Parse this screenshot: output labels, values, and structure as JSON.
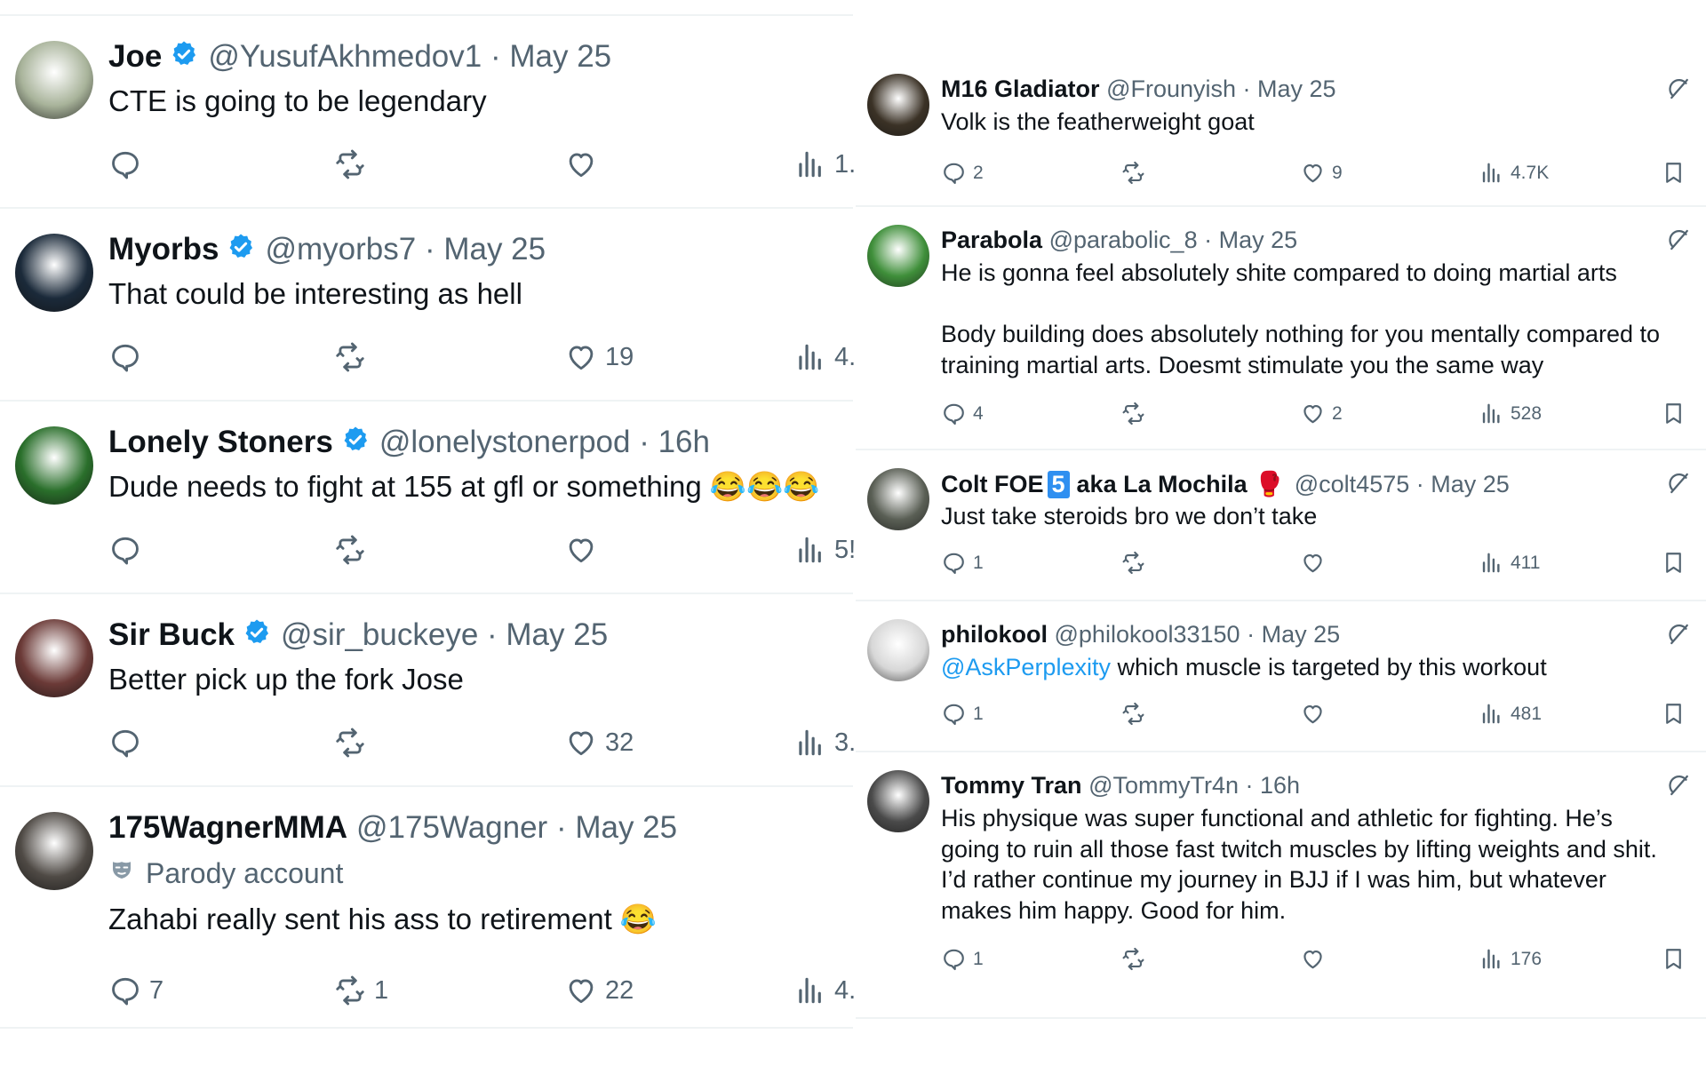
{
  "left": [
    {
      "name": "Joe",
      "handle": "@YusufAkhmedov1",
      "time": "May 25",
      "text": "CTE is going to be legendary",
      "replies": "",
      "retweets": "",
      "likes": "",
      "views": "1.",
      "avatar": "#a8b39a"
    },
    {
      "name": "Myorbs",
      "handle": "@myorbs7",
      "time": "May 25",
      "text": "That could be interesting as hell",
      "replies": "",
      "retweets": "",
      "likes": "19",
      "views": "4.",
      "avatar": "#1b2a3a"
    },
    {
      "name": "Lonely Stoners",
      "handle": "@lonelystonerpod",
      "time": "16h",
      "text": "Dude needs to fight at 155 at gfl or something 😂😂😂",
      "replies": "",
      "retweets": "",
      "likes": "",
      "views": "5!",
      "avatar": "#2a6f2b"
    },
    {
      "name": "Sir Buck",
      "handle": "@sir_buckeye",
      "time": "May 25",
      "text": "Better pick up the fork Jose",
      "replies": "",
      "retweets": "",
      "likes": "32",
      "views": "3.",
      "avatar": "#6b3a37"
    },
    {
      "name": "175WagnerMMA",
      "handle": "@175Wagner",
      "time": "May 25",
      "label": "Parody account",
      "text": "Zahabi really sent his ass to retirement 😂",
      "replies": "7",
      "retweets": "1",
      "likes": "22",
      "views": "4.",
      "avatar": "#4f4a45"
    }
  ],
  "right": [
    {
      "name": "M16 Gladiator",
      "handle": "@Frounyish",
      "time": "May 25",
      "text": "Volk is the featherweight goat",
      "replies": "2",
      "retweets": "",
      "likes": "9",
      "views": "4.7K",
      "avatar": "#3b3226"
    },
    {
      "name": "Parabola",
      "handle": "@parabolic_8",
      "time": "May 25",
      "text": "He is gonna feel absolutely shite compared to doing martial arts\n\nBody building does absolutely nothing for you mentally compared to training martial arts. Doesmt stimulate you the same way",
      "replies": "4",
      "retweets": "",
      "likes": "2",
      "views": "528",
      "avatar": "#3f8f3a"
    },
    {
      "name": "Colt FOE",
      "badge": "5",
      "name_suffix": "aka La Mochila",
      "emoji": "🥊",
      "handle": "@colt4575",
      "time": "May 25",
      "text": "Just take steroids bro we don’t take",
      "replies": "1",
      "retweets": "",
      "likes": "",
      "views": "411",
      "avatar": "#5a5f55"
    },
    {
      "name": "philokool",
      "handle": "@philokool33150",
      "time": "May 25",
      "mention": "@AskPerplexity",
      "text": "which muscle is targeted by this workout",
      "replies": "1",
      "retweets": "",
      "likes": "",
      "views": "481",
      "avatar": "#d7d7d7"
    },
    {
      "name": "Tommy Tran",
      "handle": "@TommyTr4n",
      "time": "16h",
      "text": "His physique was super functional and athletic for fighting. He’s going to ruin all those fast twitch muscles by lifting weights and shit. I’d rather continue my journey in BJJ if I was him, but whatever makes him happy. Good for him.",
      "replies": "1",
      "retweets": "",
      "likes": "",
      "views": "176",
      "avatar": "#4a4a4a"
    }
  ],
  "colors": {
    "accent": "#1d9bf0",
    "muted": "#536471",
    "divider": "#eff3f4",
    "badge": "#2f8ff0"
  }
}
